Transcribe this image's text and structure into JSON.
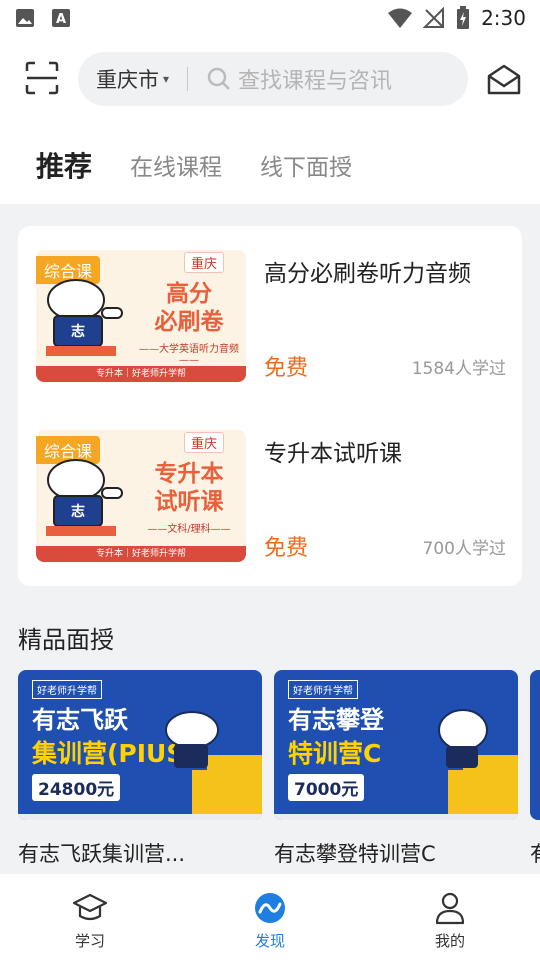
{
  "status": {
    "time": "2:30"
  },
  "header": {
    "city": "重庆市",
    "search_placeholder": "查找课程与咨讯"
  },
  "tabs": [
    {
      "label": "推荐",
      "active": true
    },
    {
      "label": "在线课程",
      "active": false
    },
    {
      "label": "线下面授",
      "active": false
    }
  ],
  "courses": [
    {
      "title": "高分必刷卷听力音频",
      "price": "免费",
      "learners": "1584人学过",
      "thumb": {
        "tag": "综合课",
        "city": "重庆",
        "line1": "高分",
        "line2": "必刷卷",
        "sub": "——大学英语听力音频——",
        "bottom": "专升本｜好老师升学帮"
      }
    },
    {
      "title": "专升本试听课",
      "price": "免费",
      "learners": "700人学过",
      "thumb": {
        "tag": "综合课",
        "city": "重庆",
        "line1": "专升本",
        "line2": "试听课",
        "sub": "——文科/理科——",
        "bottom": "专升本｜好老师升学帮"
      }
    }
  ],
  "section": {
    "title": "精品面授"
  },
  "promos": [
    {
      "name": "有志飞跃集训营...",
      "logo": "好老师升学帮",
      "line1": "有志飞跃",
      "line2": "集训营(PIUS)",
      "price": "24800元"
    },
    {
      "name": "有志攀登特训营C",
      "logo": "好老师升学帮",
      "line1": "有志攀登",
      "line2": "特训营C",
      "price": "7000元"
    },
    {
      "name": "有"
    }
  ],
  "nav": [
    {
      "label": "学习",
      "icon": "graduation-cap-icon"
    },
    {
      "label": "发现",
      "icon": "discover-icon",
      "active": true
    },
    {
      "label": "我的",
      "icon": "person-icon"
    }
  ],
  "colors": {
    "accent": "#1f7fe0",
    "price": "#f06a1a",
    "promo_bg": "#1f4fb0",
    "highlight": "#ffd200"
  }
}
